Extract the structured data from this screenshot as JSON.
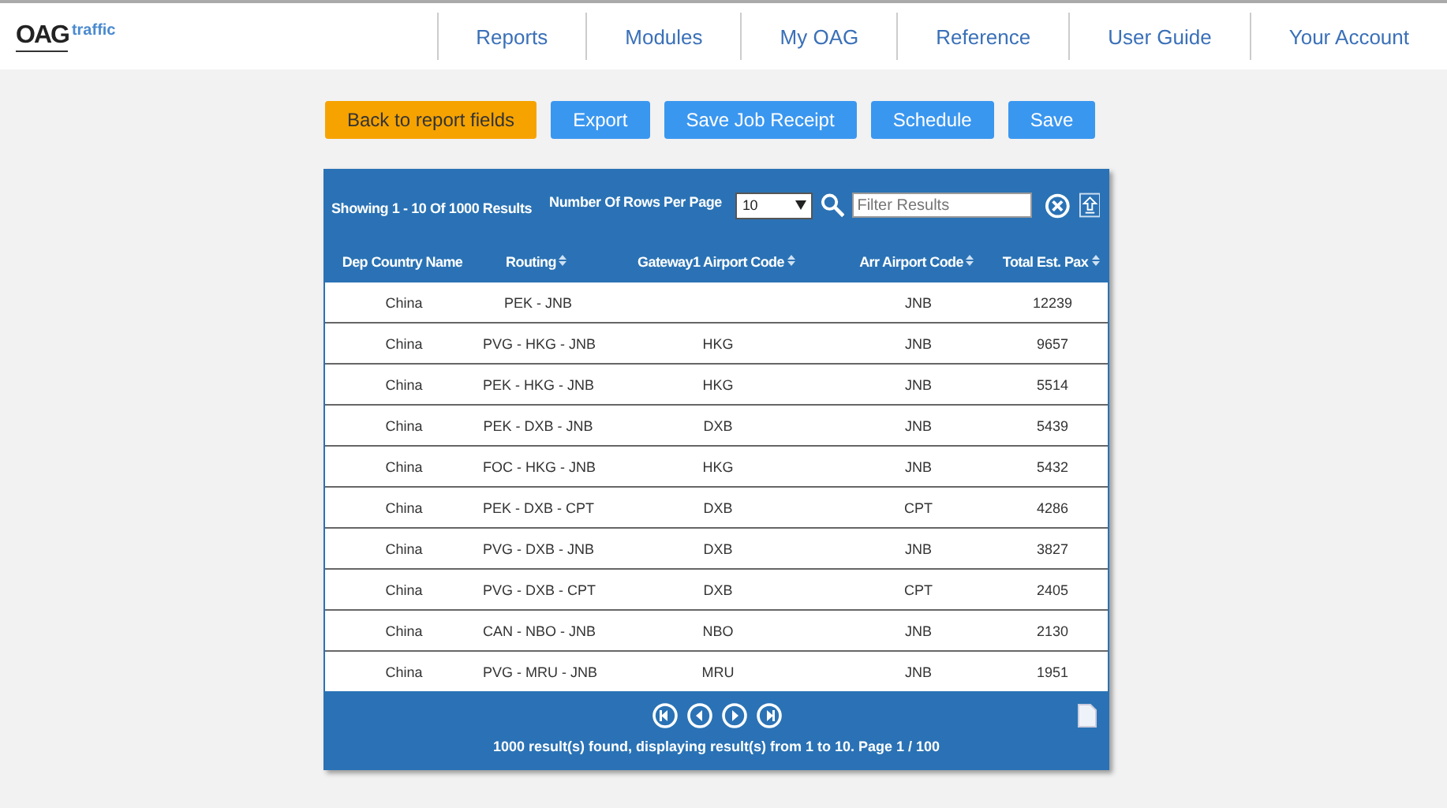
{
  "logo": {
    "main": "OAG",
    "sub": "traffic"
  },
  "nav": [
    "Reports",
    "Modules",
    "My OAG",
    "Reference",
    "User Guide",
    "Your Account"
  ],
  "actions": [
    {
      "label": "Back to report fields",
      "kind": "primary"
    },
    {
      "label": "Export",
      "kind": "default"
    },
    {
      "label": "Save Job Receipt",
      "kind": "default"
    },
    {
      "label": "Schedule",
      "kind": "default"
    },
    {
      "label": "Save",
      "kind": "default"
    }
  ],
  "toolbar": {
    "showing": "Showing 1 - 10 Of 1000 Results",
    "rows_label": "Number Of Rows Per Page",
    "rows_value": "10",
    "filter_placeholder": "Filter Results"
  },
  "table": {
    "columns": [
      {
        "label": "Dep Country Name",
        "sortable": false
      },
      {
        "label": "Routing",
        "sortable": true
      },
      {
        "label": "Gateway1 Airport Code",
        "sortable": true
      },
      {
        "label": "Arr Airport Code",
        "sortable": true
      },
      {
        "label": "Total Est. Pax",
        "sortable": true
      }
    ],
    "rows": [
      [
        "China",
        "PEK - JNB",
        "",
        "JNB",
        "12239"
      ],
      [
        "China",
        "PVG - HKG - JNB",
        "HKG",
        "JNB",
        "9657"
      ],
      [
        "China",
        "PEK - HKG - JNB",
        "HKG",
        "JNB",
        "5514"
      ],
      [
        "China",
        "PEK - DXB - JNB",
        "DXB",
        "JNB",
        "5439"
      ],
      [
        "China",
        "FOC - HKG - JNB",
        "HKG",
        "JNB",
        "5432"
      ],
      [
        "China",
        "PEK - DXB - CPT",
        "DXB",
        "CPT",
        "4286"
      ],
      [
        "China",
        "PVG - DXB - JNB",
        "DXB",
        "JNB",
        "3827"
      ],
      [
        "China",
        "PVG - DXB - CPT",
        "DXB",
        "CPT",
        "2405"
      ],
      [
        "China",
        "CAN - NBO - JNB",
        "NBO",
        "JNB",
        "2130"
      ],
      [
        "China",
        "PVG - MRU - JNB",
        "MRU",
        "JNB",
        "1951"
      ]
    ]
  },
  "footer": {
    "summary": "1000 result(s) found, displaying result(s) from 1 to 10. Page 1 / 100"
  }
}
